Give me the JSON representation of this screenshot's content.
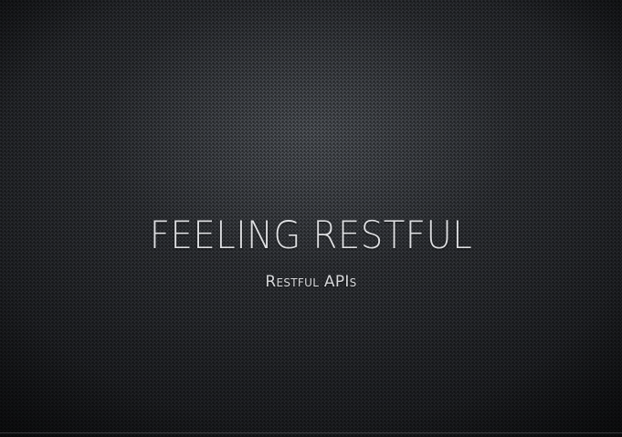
{
  "slide": {
    "title": "FEELING RESTFUL",
    "subtitle": "Restful APIs"
  },
  "colors": {
    "background": "#25272b",
    "text": "#dcdde0"
  }
}
